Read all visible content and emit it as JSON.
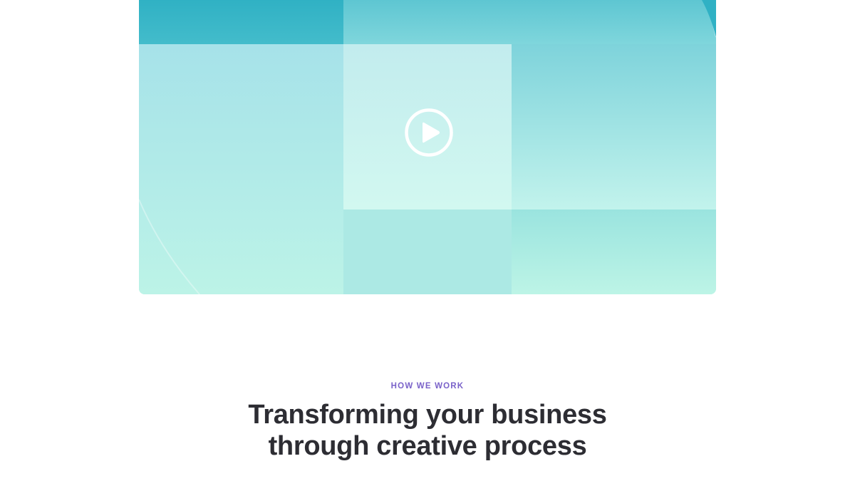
{
  "video": {
    "play_label": "Play video"
  },
  "how_we_work": {
    "eyebrow": "HOW WE WORK",
    "headline": "Transforming your business through creative process"
  },
  "colors": {
    "eyebrow": "#7a62c9",
    "headline": "#2d2d33",
    "teal_dark": "#33b3c5",
    "mint_light": "#bff5e6"
  }
}
